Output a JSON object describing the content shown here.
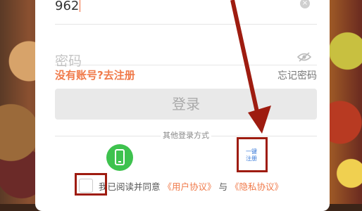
{
  "form": {
    "account_value": "962",
    "password_placeholder": "密码",
    "register_link": "没有账号?去注册",
    "forgot_link": "忘记密码",
    "login_button": "登录",
    "other_methods": "其他登录方式",
    "one_key_register_line1": "一键",
    "one_key_register_line2": "注册",
    "agree_prefix": "我已阅读并同意",
    "user_agreement": "《用户协议》",
    "and": "与",
    "privacy_agreement": "《隐私协议》"
  },
  "colors": {
    "accent": "#f07a4a",
    "annotation": "#9e1c10",
    "phone_green": "#3ec24e",
    "link_blue": "#3a7ad8"
  },
  "icons": [
    "clear-icon",
    "eye-icon",
    "phone-icon"
  ]
}
